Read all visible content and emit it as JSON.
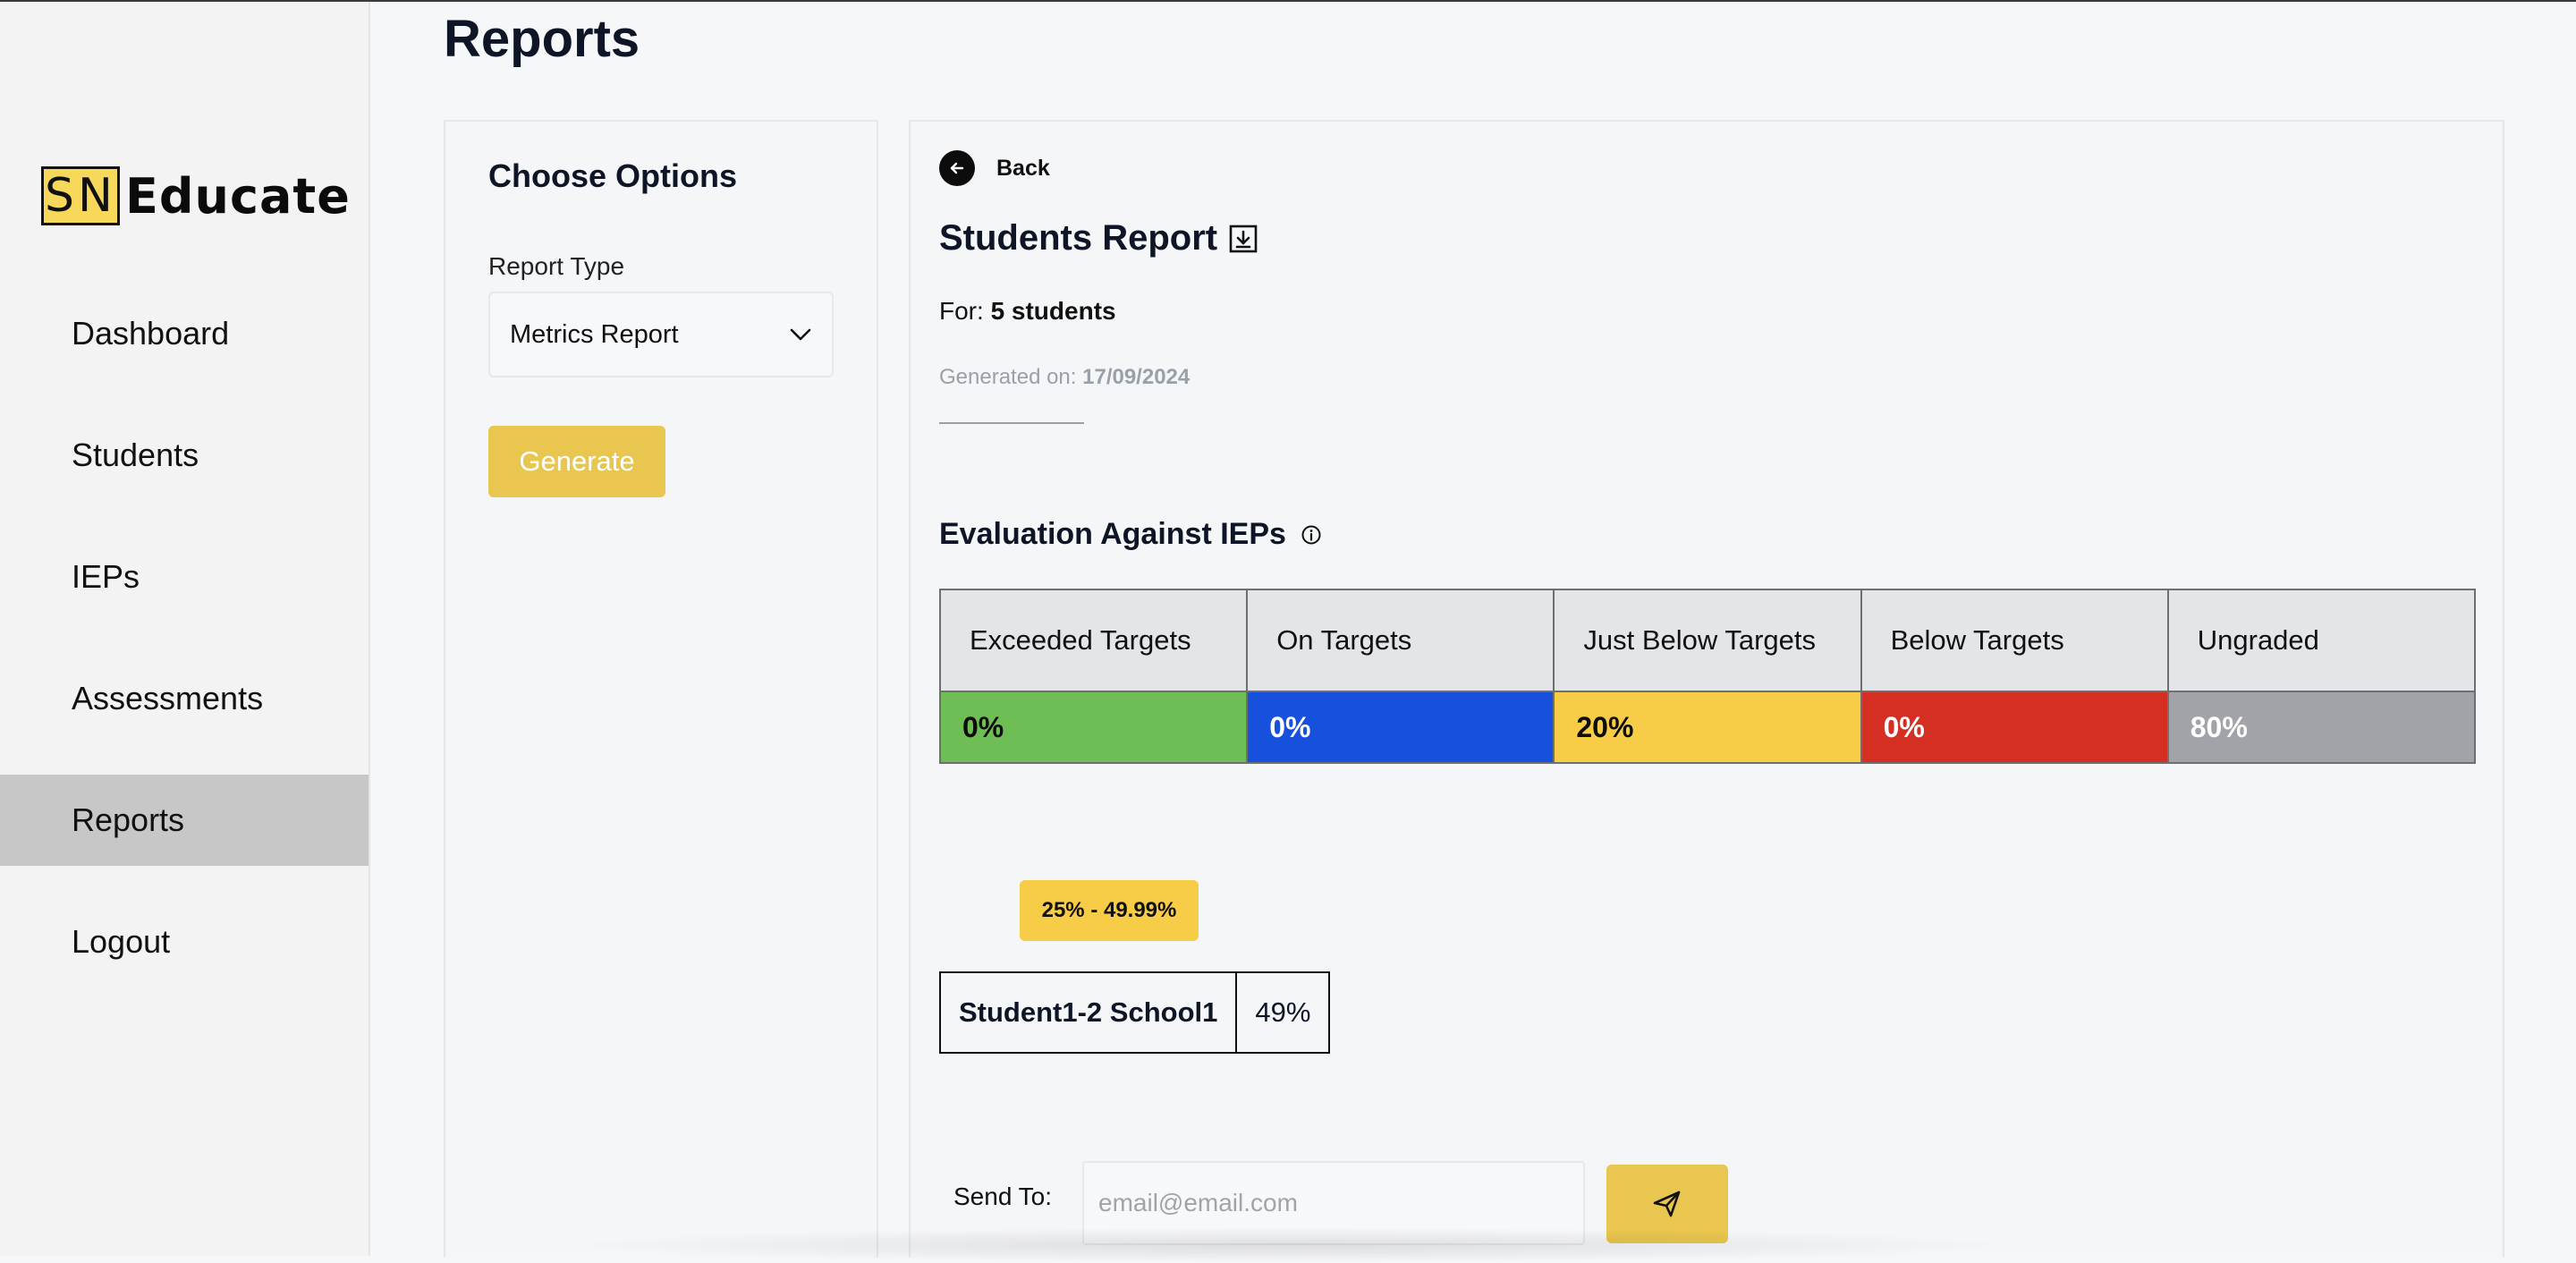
{
  "app": {
    "logo_mark": "SN",
    "logo_text": "Educate"
  },
  "sidebar": {
    "items": [
      {
        "label": "Dashboard"
      },
      {
        "label": "Students"
      },
      {
        "label": "IEPs"
      },
      {
        "label": "Assessments"
      },
      {
        "label": "Reports",
        "active": true
      },
      {
        "label": "Logout"
      }
    ]
  },
  "page": {
    "title": "Reports"
  },
  "options": {
    "title": "Choose Options",
    "report_type_label": "Report Type",
    "report_type_value": "Metrics Report",
    "generate_label": "Generate"
  },
  "report": {
    "back_label": "Back",
    "title": "Students Report",
    "for_prefix": "For:",
    "for_value": "5 students",
    "generated_prefix": "Generated on:",
    "generated_value": "17/09/2024",
    "evaluation_title": "Evaluation Against IEPs",
    "evaluation": {
      "headers": [
        "Exceeded Targets",
        "On Targets",
        "Just Below Targets",
        "Below Targets",
        "Ungraded"
      ],
      "values": [
        "0%",
        "0%",
        "20%",
        "0%",
        "80%"
      ],
      "colors": [
        "#6fbd55",
        "#1650dd",
        "#f7cc47",
        "#d52f24",
        "#a2a3a9"
      ]
    },
    "range_badge": "25% - 49.99%",
    "student": {
      "name": "Student1-2 School1",
      "score": "49%"
    },
    "send_to_label": "Send To:",
    "email_placeholder": "email@email.com"
  },
  "icons": [
    "arrow-left-icon",
    "download-icon",
    "info-icon",
    "chevron-down-icon",
    "send-icon"
  ]
}
